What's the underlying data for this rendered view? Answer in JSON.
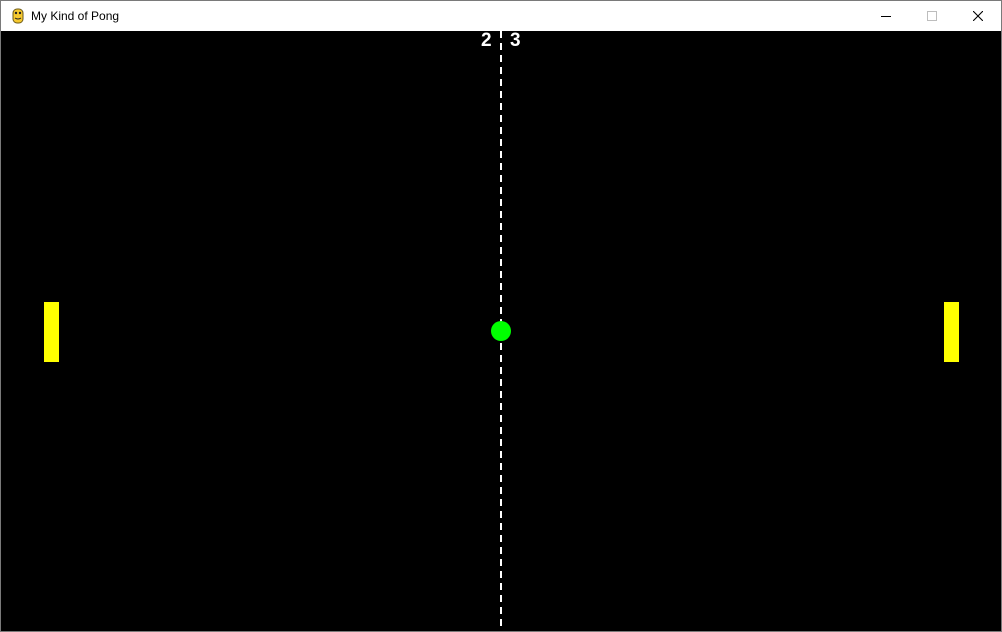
{
  "window": {
    "title": "My Kind of Pong",
    "app_icon": "python-snake-icon",
    "controls": {
      "minimize_icon": "minimize-icon",
      "maximize_icon": "maximize-icon",
      "close_icon": "close-icon"
    }
  },
  "game": {
    "score": {
      "left": "2",
      "right": "3"
    },
    "colors": {
      "background": "#000000",
      "paddles": "#ffff00",
      "ball": "#00ff00",
      "center_line": "#ffffff",
      "score_text": "#ffffff"
    }
  }
}
